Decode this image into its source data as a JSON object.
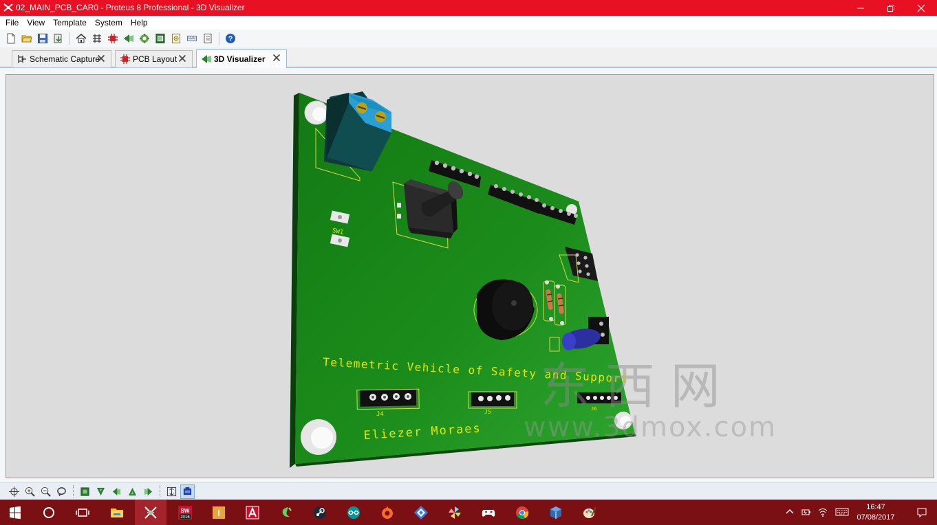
{
  "window": {
    "title": "02_MAIN_PCB_CAR0 - Proteus 8 Professional - 3D Visualizer",
    "title_bar_color": "#e81123"
  },
  "menu": {
    "items": [
      "File",
      "View",
      "Template",
      "System",
      "Help"
    ]
  },
  "toolbar": {
    "icons": [
      "new-file-icon",
      "open-folder-icon",
      "save-icon",
      "import-icon",
      "home-icon",
      "schematic-icon",
      "pcb-icon",
      "3d-visualizer-icon",
      "gerber-icon",
      "bom-icon",
      "design-explorer-icon",
      "notes-icon",
      "help-icon"
    ]
  },
  "tabs": [
    {
      "label": "Schematic Capture",
      "icon": "schematic-icon",
      "active": false
    },
    {
      "label": "PCB Layout",
      "icon": "pcb-chip-icon",
      "active": false
    },
    {
      "label": "3D Visualizer",
      "icon": "3d-visualizer-icon",
      "active": true
    }
  ],
  "board": {
    "silkscreen_title": "Telemetric Vehicle of Safety and Support",
    "silkscreen_author": "Eliezer Moraes",
    "component_labels": {
      "sw1": "SW1",
      "j4": "J4",
      "j5": "J5",
      "j6": "J6"
    },
    "pcb_color": "#1e8a1e",
    "silkscreen_color": "#e6e600"
  },
  "watermark": {
    "text_cn": "东 西 网",
    "text_url": "www.3dmox.com"
  },
  "navbar": {
    "icons": [
      "pan-icon",
      "zoom-in-icon",
      "zoom-out-icon",
      "reset-view-icon",
      "top-view-icon",
      "front-view-icon",
      "left-view-icon",
      "back-view-icon",
      "right-view-icon",
      "board-height-icon",
      "toggle-board-icon"
    ],
    "pressed": "toggle-board-icon"
  },
  "taskbar": {
    "apps": [
      "start-icon",
      "search-circle-icon",
      "task-view-icon",
      "file-explorer-icon",
      "proteus-icon",
      "solidworks-icon",
      "inventor-icon",
      "autocad-icon",
      "app-green-icon",
      "steam-icon",
      "arduino-icon",
      "origin-icon",
      "app-blue-icon",
      "pinwheel-icon",
      "gamepad-icon",
      "chrome-icon",
      "virtualbox-icon",
      "paint-icon"
    ],
    "solidworks_label": "2016",
    "clock_time": "16:47",
    "clock_date": "07/08/2017",
    "color": "#7a0f14"
  }
}
